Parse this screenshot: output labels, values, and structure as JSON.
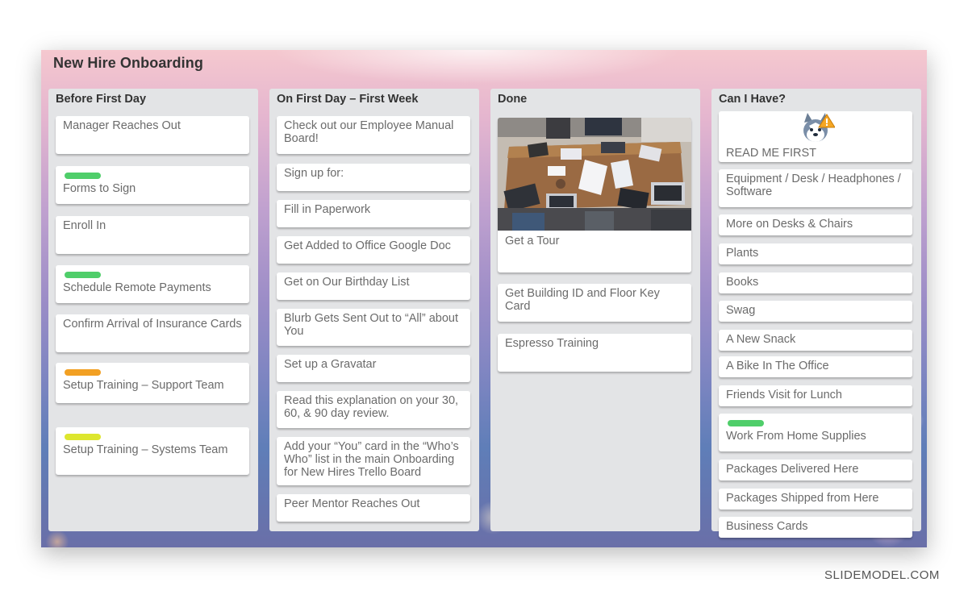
{
  "board": {
    "title": "New Hire Onboarding",
    "lists": [
      {
        "title": "Before First Day",
        "cards": [
          {
            "text": "Manager Reaches Out"
          },
          {
            "text": "Forms to Sign",
            "label_color": "#4fce6a"
          },
          {
            "text": "Enroll In"
          },
          {
            "text": "Schedule Remote Payments",
            "label_color": "#4fce6a"
          },
          {
            "text": "Confirm Arrival of Insurance Cards"
          },
          {
            "text": "Setup Training – Support Team",
            "label_color": "#f2a023"
          },
          {
            "text": "Setup Training – Systems Team",
            "label_color": "#dde62e"
          }
        ]
      },
      {
        "title": "On First Day – First Week",
        "cards": [
          {
            "text": "Check out our Employee Manual Board!"
          },
          {
            "text": "Sign up for:"
          },
          {
            "text": "Fill in Paperwork"
          },
          {
            "text": "Get Added to Office Google Doc"
          },
          {
            "text": "Get on Our Birthday List"
          },
          {
            "text": "Blurb Gets Sent Out to “All” about You"
          },
          {
            "text": "Set up a Gravatar"
          },
          {
            "text": "Read this explanation on your 30, 60, & 90 day review."
          },
          {
            "text": "Add your “You” card in the “Who’s Who” list in the main Onboarding for New Hires Trello Board"
          },
          {
            "text": "Peer Mentor Reaches Out"
          }
        ]
      },
      {
        "title": "Done",
        "cards": [
          {
            "text": "Get a Tour",
            "cover": "office-meeting-photo"
          },
          {
            "text": "Get Building ID and Floor Key Card"
          },
          {
            "text": "Espresso Training"
          }
        ]
      },
      {
        "title": "Can I Have?",
        "cards": [
          {
            "text": "READ ME FIRST",
            "sticker": "husky-alert-sticker"
          },
          {
            "text": "Equipment / Desk / Headphones / Software"
          },
          {
            "text": "More on Desks & Chairs"
          },
          {
            "text": "Plants"
          },
          {
            "text": "Books"
          },
          {
            "text": "Swag"
          },
          {
            "text": "A New Snack"
          },
          {
            "text": "A Bike In The Office"
          },
          {
            "text": "Friends Visit for Lunch"
          },
          {
            "text": "Work From Home Supplies",
            "label_color": "#4fce6a"
          },
          {
            "text": "Packages Delivered Here"
          },
          {
            "text": "Packages Shipped from Here"
          },
          {
            "text": "Business Cards"
          }
        ]
      }
    ]
  },
  "watermark": "SLIDEMODEL.COM"
}
